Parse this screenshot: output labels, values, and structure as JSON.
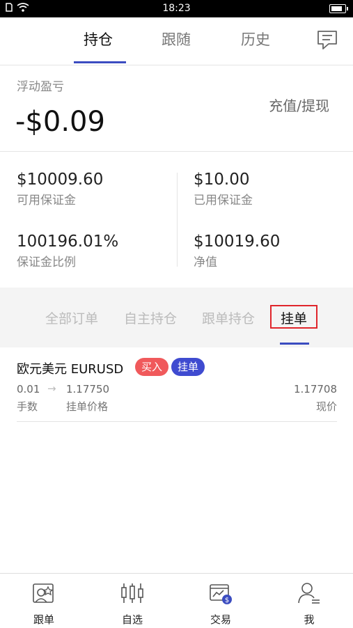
{
  "status_bar": {
    "time": "18:23",
    "battery_level": 0.85
  },
  "tabs": [
    {
      "label": "持仓",
      "active": true
    },
    {
      "label": "跟随",
      "active": false
    },
    {
      "label": "历史",
      "active": false
    }
  ],
  "summary": {
    "float_label": "浮动盈亏",
    "float_value": "-$0.09",
    "deposit_withdraw": "充值/提现"
  },
  "stats": [
    {
      "value": "$10009.60",
      "label": "可用保证金"
    },
    {
      "value": "$10.00",
      "label": "已用保证金"
    },
    {
      "value": "100196.01%",
      "label": "保证金比例"
    },
    {
      "value": "$10019.60",
      "label": "净值"
    }
  ],
  "subtabs": [
    {
      "label": "全部订单"
    },
    {
      "label": "自主持仓"
    },
    {
      "label": "跟单持仓"
    },
    {
      "label": "挂单"
    }
  ],
  "order": {
    "name": "欧元美元 EURUSD",
    "badge_buy": "买入",
    "badge_pending": "挂单",
    "lots": "0.01",
    "lots_label": "手数",
    "arrow": "→",
    "pending_price": "1.17750",
    "pending_price_label": "挂单价格",
    "current_price": "1.17708",
    "current_price_label": "现价"
  },
  "bottom_nav": [
    {
      "label": "跟单"
    },
    {
      "label": "自选"
    },
    {
      "label": "交易"
    },
    {
      "label": "我"
    }
  ],
  "colors": {
    "accent": "#3b4cc0",
    "buy": "#f0595b",
    "pending": "#3f4bd0",
    "highlight_box": "#e0252b"
  }
}
